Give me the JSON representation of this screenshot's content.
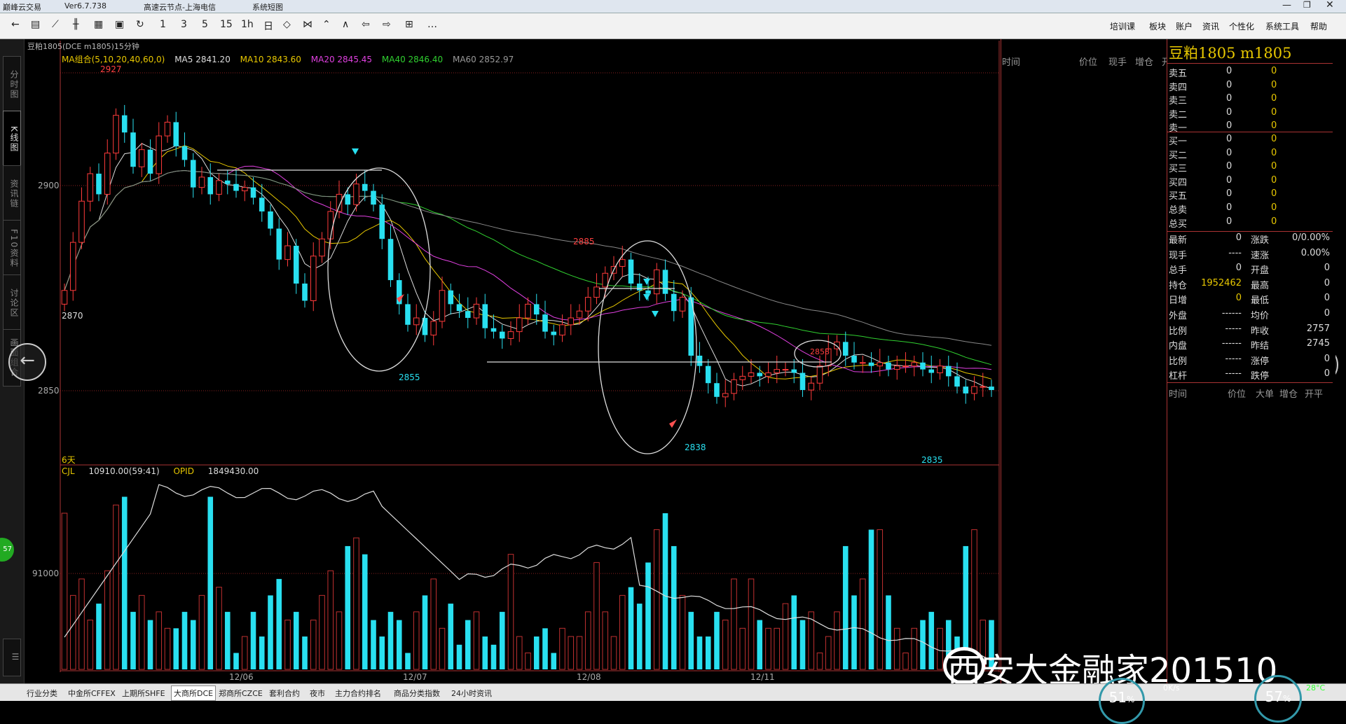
{
  "titlebar": {
    "app": "巅峰云交易",
    "version": "Ver6.7.738",
    "server": "高速云节点-上海电信",
    "sys": "系统短图"
  },
  "toolbar": {
    "periods": [
      "1",
      "3",
      "5",
      "15",
      "1h",
      "日"
    ],
    "menus": [
      "培训课",
      "板块",
      "账户",
      "资讯",
      "个性化",
      "系统工具",
      "帮助"
    ]
  },
  "lefttabs": [
    "分时图",
    "K线图",
    "资讯链",
    "F10资料",
    "讨论区",
    "画面组合"
  ],
  "chart": {
    "header": "豆粕1805(DCE m1805)15分钟",
    "ma_combo": "MA组合(5,10,20,40,60,0)",
    "ma5": "MA5 2841.20",
    "ma10": "MA10 2843.60",
    "ma20": "MA20 2845.45",
    "ma40": "MA40 2846.40",
    "ma60": "MA60 2852.97",
    "y_ticks": [
      "2900",
      "2850"
    ],
    "vol_tick": "91000",
    "days_label": "6天",
    "cjl": "CJL",
    "cjl_value": "10910.00(59:41)",
    "opid": "OPID",
    "opid_value": "1849430.00",
    "annotations": {
      "high": "2927",
      "open": "2870",
      "a2855": "2855",
      "a2885": "2885",
      "a2838": "2838",
      "a2858": "2858",
      "a2835": "2835"
    },
    "dates": [
      "12/06",
      "12/07",
      "12/08",
      "12/11"
    ]
  },
  "chart_data": {
    "type": "candlestick",
    "title": "豆粕1805(DCE m1805)15分钟",
    "price_ticks": [
      2900,
      2850
    ],
    "volume_tick": 91000,
    "labeled_extremes": [
      {
        "label": "2927",
        "type": "high"
      },
      {
        "label": "2870",
        "type": "open"
      },
      {
        "label": "2855",
        "type": "low"
      },
      {
        "label": "2885",
        "type": "high"
      },
      {
        "label": "2838",
        "type": "low"
      },
      {
        "label": "2858",
        "type": "high"
      },
      {
        "label": "2835",
        "type": "low"
      }
    ],
    "categories": [
      "12/06",
      "12/07",
      "12/08",
      "12/11"
    ],
    "ma": {
      "MA5": 2841.2,
      "MA10": 2843.6,
      "MA20": 2845.45,
      "MA40": 2846.4,
      "MA60": 2852.97
    },
    "closes": [
      2870,
      2884,
      2896,
      2904,
      2898,
      2910,
      2921,
      2916,
      2906,
      2911,
      2904,
      2915,
      2919,
      2912,
      2908,
      2900,
      2903,
      2898,
      2902,
      2901,
      2899,
      2900,
      2897,
      2893,
      2888,
      2879,
      2883,
      2872,
      2867,
      2880,
      2885,
      2893,
      2898,
      2895,
      2901,
      2899,
      2895,
      2885,
      2873,
      2866,
      2860,
      2862,
      2857,
      2861,
      2870,
      2866,
      2864,
      2862,
      2866,
      2859,
      2858,
      2856,
      2858,
      2862,
      2866,
      2863,
      2858,
      2857,
      2860,
      2862,
      2864,
      2868,
      2871,
      2875,
      2877,
      2879,
      2872,
      2870,
      2869,
      2876,
      2869,
      2864,
      2868,
      2851,
      2848,
      2843,
      2839,
      2840,
      2844,
      2845,
      2846,
      2845,
      2846,
      2847,
      2847,
      2846,
      2841,
      2843,
      2848,
      2853,
      2855,
      2851,
      2849,
      2849,
      2848,
      2849,
      2847,
      2848,
      2848,
      2849,
      2847,
      2846,
      2848,
      2845,
      2842,
      2840,
      2842,
      2842,
      2841
    ],
    "volumes": [
      190,
      90,
      110,
      60,
      80,
      120,
      200,
      210,
      70,
      90,
      60,
      70,
      50,
      50,
      70,
      60,
      90,
      210,
      100,
      70,
      20,
      40,
      70,
      40,
      90,
      110,
      60,
      70,
      40,
      60,
      90,
      120,
      70,
      150,
      160,
      140,
      60,
      40,
      70,
      60,
      20,
      70,
      90,
      110,
      50,
      80,
      30,
      60,
      70,
      40,
      30,
      70,
      140,
      40,
      20,
      40,
      50,
      20,
      50,
      40,
      40,
      70,
      130,
      70,
      40,
      90,
      100,
      80,
      130,
      170,
      190,
      150,
      90,
      70,
      40,
      40,
      70,
      60,
      110,
      50,
      110,
      60,
      50,
      50,
      80,
      90,
      60,
      70,
      20,
      40,
      70,
      150,
      90,
      110,
      170,
      170,
      90,
      50,
      20,
      50,
      60,
      70,
      50,
      60,
      40,
      150,
      170,
      60,
      60
    ],
    "ylim": [
      2820,
      2935
    ]
  },
  "depth": {
    "title": "豆粕1805  m1805",
    "asks": [
      {
        "label": "卖五",
        "price": "0",
        "vol": "0"
      },
      {
        "label": "卖四",
        "price": "0",
        "vol": "0"
      },
      {
        "label": "卖三",
        "price": "0",
        "vol": "0"
      },
      {
        "label": "卖二",
        "price": "0",
        "vol": "0"
      },
      {
        "label": "卖一",
        "price": "0",
        "vol": "0"
      }
    ],
    "bids": [
      {
        "label": "买一",
        "price": "0",
        "vol": "0"
      },
      {
        "label": "买二",
        "price": "0",
        "vol": "0"
      },
      {
        "label": "买三",
        "price": "0",
        "vol": "0"
      },
      {
        "label": "买四",
        "price": "0",
        "vol": "0"
      },
      {
        "label": "买五",
        "price": "0",
        "vol": "0"
      },
      {
        "label": "总卖",
        "price": "0",
        "vol": "0"
      },
      {
        "label": "总买",
        "price": "0",
        "vol": "0"
      }
    ]
  },
  "quote": [
    {
      "l1": "最新",
      "v1": "0",
      "l2": "涨跌",
      "v2": "0/0.00%"
    },
    {
      "l1": "现手",
      "v1": "----",
      "l2": "速涨",
      "v2": "0.00%"
    },
    {
      "l1": "总手",
      "v1": "0",
      "l2": "开盘",
      "v2": "0"
    },
    {
      "l1": "持仓",
      "v1": "1952462",
      "l2": "最高",
      "v2": "0"
    },
    {
      "l1": "日增",
      "v1": "0",
      "l2": "最低",
      "v2": "0"
    },
    {
      "l1": "外盘",
      "v1": "------",
      "l2": "均价",
      "v2": "0"
    },
    {
      "l1": "比例",
      "v1": "-----",
      "l2": "昨收",
      "v2": "2757"
    },
    {
      "l1": "内盘",
      "v1": "------",
      "l2": "昨结",
      "v2": "2745"
    },
    {
      "l1": "比例",
      "v1": "-----",
      "l2": "涨停",
      "v2": "0"
    },
    {
      "l1": "杠杆",
      "v1": "-----",
      "l2": "跌停",
      "v2": "0"
    }
  ],
  "tick_headers_top": [
    "时间",
    "价位",
    "现手",
    "增仓",
    "开平"
  ],
  "tick_headers_bottom": [
    "时间",
    "价位",
    "大单",
    "增仓",
    "开平"
  ],
  "bottombar": [
    "行业分类",
    "中金所CFFEX",
    "上期所SHFE",
    "大商所DCE",
    "郑商所CZCE",
    "套利合约",
    "夜市",
    "主力合约排名",
    "商品分类指数",
    "24小时资讯"
  ],
  "watermark": "西安大金融家201510",
  "tray": {
    "net_pct": "51",
    "net_speed": "0K/s",
    "cpu_pct": "57",
    "cpu_temp": "28°C",
    "left_badge": "57"
  }
}
